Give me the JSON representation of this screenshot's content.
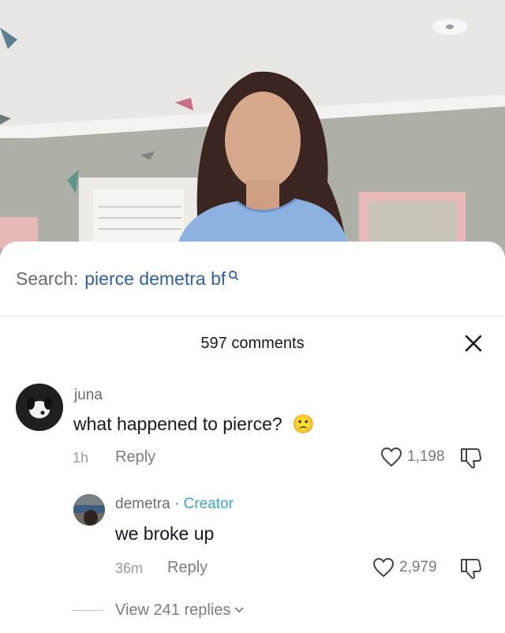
{
  "search": {
    "prefix": "Search:",
    "term": "pierce demetra bf"
  },
  "comments_header": {
    "count_label": "597 comments"
  },
  "comment": {
    "username": "juna",
    "text": "what happened to pierce?",
    "emoji": "🙁",
    "time": "1h",
    "reply_label": "Reply",
    "likes": "1,198"
  },
  "reply": {
    "username": "demetra",
    "separator": "·",
    "badge": "Creator",
    "text": "we broke up",
    "time": "36m",
    "reply_label": "Reply",
    "likes": "2,979"
  },
  "view_replies": {
    "label": "View 241 replies"
  },
  "colors": {
    "accent_link": "#2f5fa6",
    "creator": "#3aa8c1",
    "text": "#161823",
    "muted": "#7d7d7d"
  },
  "icons": [
    "search-icon",
    "close-icon",
    "heart-icon",
    "dislike-icon",
    "chevron-down-icon"
  ]
}
